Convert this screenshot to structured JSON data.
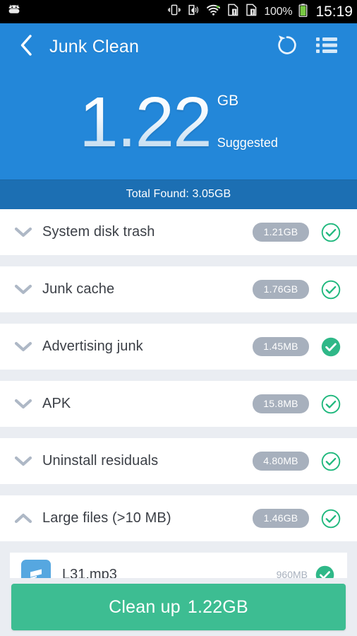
{
  "statusbar": {
    "icons": [
      "android-robot-icon",
      "vibrate-icon",
      "sound-icon",
      "wifi-icon",
      "sim1-alert-icon",
      "sim2-alert-icon"
    ],
    "battery_percent": "100%",
    "battery_icon": "battery-full-icon",
    "time": "15:19"
  },
  "appbar": {
    "back_icon": "back-chevron-icon",
    "title": "Junk Clean",
    "refresh_icon": "refresh-icon",
    "list_icon": "list-menu-icon"
  },
  "hero": {
    "amount": "1.22",
    "unit": "GB",
    "caption": "Suggested"
  },
  "total_band": {
    "text": "Total Found: 3.05GB"
  },
  "categories": [
    {
      "label": "System disk trash",
      "size": "1.21GB",
      "expanded": false,
      "checked": "outline",
      "chevron": "chevron-down-icon"
    },
    {
      "label": "Junk cache",
      "size": "1.76GB",
      "expanded": false,
      "checked": "outline",
      "chevron": "chevron-down-icon"
    },
    {
      "label": "Advertising junk",
      "size": "1.45MB",
      "expanded": false,
      "checked": "filled",
      "chevron": "chevron-down-icon"
    },
    {
      "label": "APK",
      "size": "15.8MB",
      "expanded": false,
      "checked": "outline",
      "chevron": "chevron-down-icon"
    },
    {
      "label": "Uninstall residuals",
      "size": "4.80MB",
      "expanded": false,
      "checked": "outline",
      "chevron": "chevron-down-icon"
    },
    {
      "label": "Large files (>10 MB)",
      "size": "1.46GB",
      "expanded": true,
      "checked": "outline",
      "chevron": "chevron-up-icon"
    }
  ],
  "child_file": {
    "name": "L31.mp3",
    "size": "960MB",
    "icon": "music-file-icon",
    "checked": "filled"
  },
  "bottom": {
    "action_label": "Clean up",
    "action_amount": "1.22GB"
  },
  "colors": {
    "header_blue": "#2387d9",
    "band_blue": "#1c6fb3",
    "page_bg": "#eaedf2",
    "badge_gray": "#a7b0bd",
    "green": "#3dbd92",
    "green_outline": "#1fb87d",
    "text_dark": "#3b3f46",
    "chevron_gray": "#aeb8c6",
    "file_icon_blue": "#56a7e0"
  }
}
